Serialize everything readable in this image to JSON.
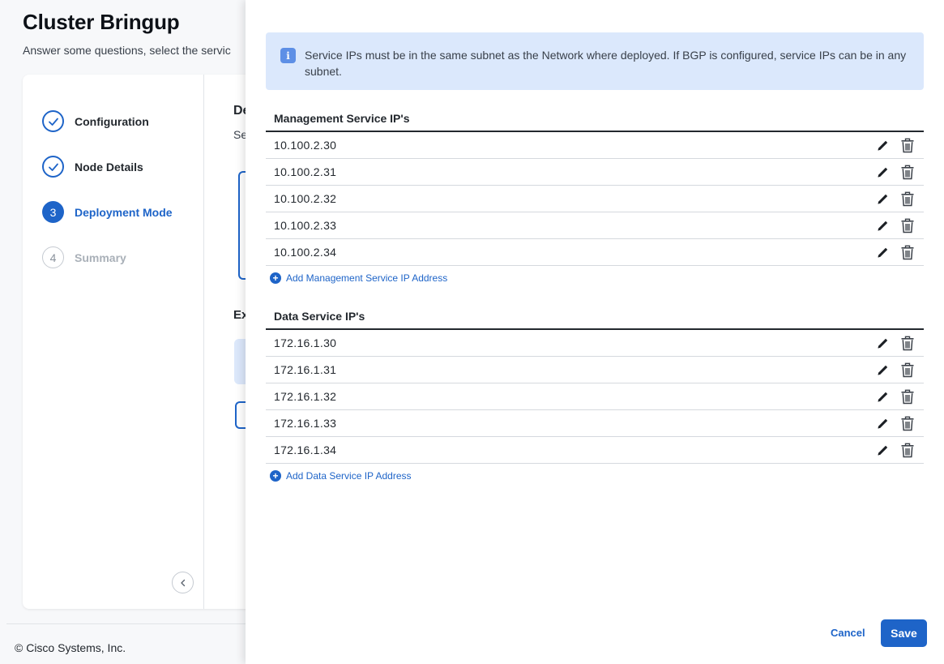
{
  "page": {
    "title": "Cluster Bringup",
    "subtitle": "Answer some questions, select the servic"
  },
  "wizard": {
    "steps": [
      {
        "marker": "",
        "label": "Configuration",
        "state": "done"
      },
      {
        "marker": "",
        "label": "Node Details",
        "state": "done"
      },
      {
        "marker": "3",
        "label": "Deployment Mode",
        "state": "active"
      },
      {
        "marker": "4",
        "label": "Summary",
        "state": "pending"
      }
    ]
  },
  "peek": {
    "heading": "De",
    "sub": "Se",
    "heading2": "Ex"
  },
  "footer": {
    "copyright": "© Cisco Systems, Inc."
  },
  "drawer": {
    "info_text": "Service IPs must be in the same subnet as the Network where deployed. If BGP is configured, service IPs can be in any subnet.",
    "management": {
      "title": "Management Service IP's",
      "ips": [
        "10.100.2.30",
        "10.100.2.31",
        "10.100.2.32",
        "10.100.2.33",
        "10.100.2.34"
      ],
      "add_label": "Add Management Service IP Address"
    },
    "data": {
      "title": "Data Service IP's",
      "ips": [
        "172.16.1.30",
        "172.16.1.31",
        "172.16.1.32",
        "172.16.1.33",
        "172.16.1.34"
      ],
      "add_label": "Add Data Service IP Address"
    },
    "cancel_label": "Cancel",
    "save_label": "Save"
  },
  "colors": {
    "accent": "#1e64c8",
    "info_background": "#dbe8fc",
    "info_icon": "#5d8fe6"
  },
  "icons": [
    "check-icon",
    "chevron-left-icon",
    "info-icon",
    "pencil-icon",
    "trash-icon",
    "plus-circle-icon"
  ]
}
